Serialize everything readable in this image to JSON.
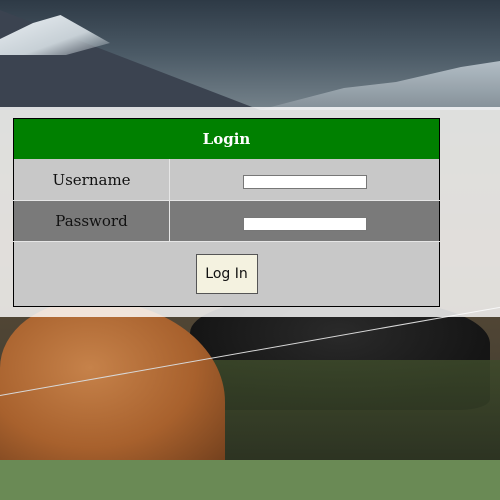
{
  "form": {
    "title": "Login",
    "username_label": "Username",
    "username_value": "",
    "password_label": "Password",
    "password_value": "",
    "submit_label": "Log In"
  },
  "colors": {
    "header_bg": "#008000",
    "row_light": "#c8c8c8",
    "row_dark": "#7a7a7a",
    "button_bg": "#f4f2e0",
    "footer_strip": "#6a8a55"
  }
}
